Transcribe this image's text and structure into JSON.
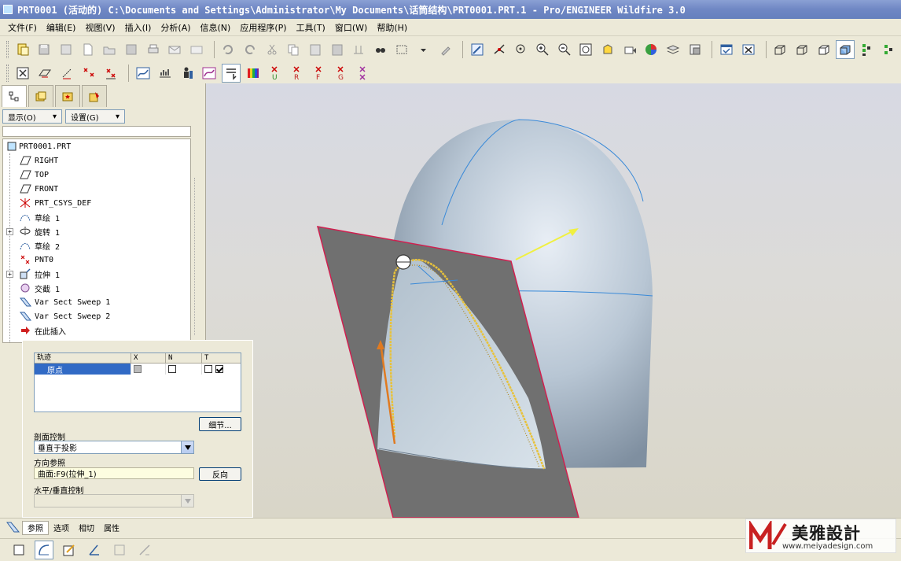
{
  "window": {
    "title": "PRT0001 (活动的) C:\\Documents and Settings\\Administrator\\My Documents\\话筒结构\\PRT0001.PRT.1 - Pro/ENGINEER Wildfire 3.0"
  },
  "menu": {
    "items": [
      {
        "label": "文件(F)"
      },
      {
        "label": "编辑(E)"
      },
      {
        "label": "视图(V)"
      },
      {
        "label": "插入(I)"
      },
      {
        "label": "分析(A)"
      },
      {
        "label": "信息(N)"
      },
      {
        "label": "应用程序(P)"
      },
      {
        "label": "工具(T)"
      },
      {
        "label": "窗口(W)"
      },
      {
        "label": "帮助(H)"
      }
    ]
  },
  "model_tree": {
    "show_button": "显示(O)",
    "settings_button": "设置(G)",
    "items": [
      {
        "label": "PRT0001.PRT",
        "icon": "part-icon"
      },
      {
        "label": "RIGHT",
        "icon": "datum-plane-icon"
      },
      {
        "label": "TOP",
        "icon": "datum-plane-icon"
      },
      {
        "label": "FRONT",
        "icon": "datum-plane-icon"
      },
      {
        "label": "PRT_CSYS_DEF",
        "icon": "csys-icon"
      },
      {
        "label": "草绘 1",
        "icon": "sketch-icon"
      },
      {
        "label": "旋转 1",
        "icon": "revolve-icon"
      },
      {
        "label": "草绘 2",
        "icon": "sketch-icon"
      },
      {
        "label": "PNT0",
        "icon": "datum-point-icon"
      },
      {
        "label": "拉伸 1",
        "icon": "extrude-icon"
      },
      {
        "label": "交截 1",
        "icon": "intersect-icon"
      },
      {
        "label": "Var Sect Sweep 1",
        "icon": "var-sect-sweep-icon"
      },
      {
        "label": "Var Sect Sweep 2",
        "icon": "var-sect-sweep-icon"
      },
      {
        "label": "在此插入",
        "icon": "insert-here-arrow-icon"
      }
    ]
  },
  "dashboard": {
    "table": {
      "headers": [
        "轨迹",
        "X",
        "N",
        "T"
      ],
      "rows": [
        {
          "name": "原点",
          "x": "gray",
          "n": false,
          "t": [
            false,
            true
          ]
        }
      ]
    },
    "details_button": "细节...",
    "section_control_label": "剖面控制",
    "section_control_value": "垂直于投影",
    "direction_ref_label": "方向参照",
    "direction_ref_value": "曲面:F9(拉伸_1)",
    "flip_button": "反向",
    "hv_control_label": "水平/垂直控制",
    "hv_control_value": ""
  },
  "dash_tabs": [
    {
      "label": "参照",
      "active": true
    },
    {
      "label": "选项",
      "active": false
    },
    {
      "label": "相切",
      "active": false
    },
    {
      "label": "属性",
      "active": false
    }
  ],
  "watermark": {
    "main": "美雅設計",
    "sub": "www.meiyadesign.com"
  },
  "colors": {
    "title_bar": "#6f87c4",
    "selection": "#316ac5",
    "model_surface": "#a9b8c8",
    "datum_plane": "#7a7a7a",
    "plane_border": "#d02050",
    "trajectory": "#e8c23a",
    "arrow_orange": "#e07a20",
    "arrow_yellow": "#f0f040"
  }
}
